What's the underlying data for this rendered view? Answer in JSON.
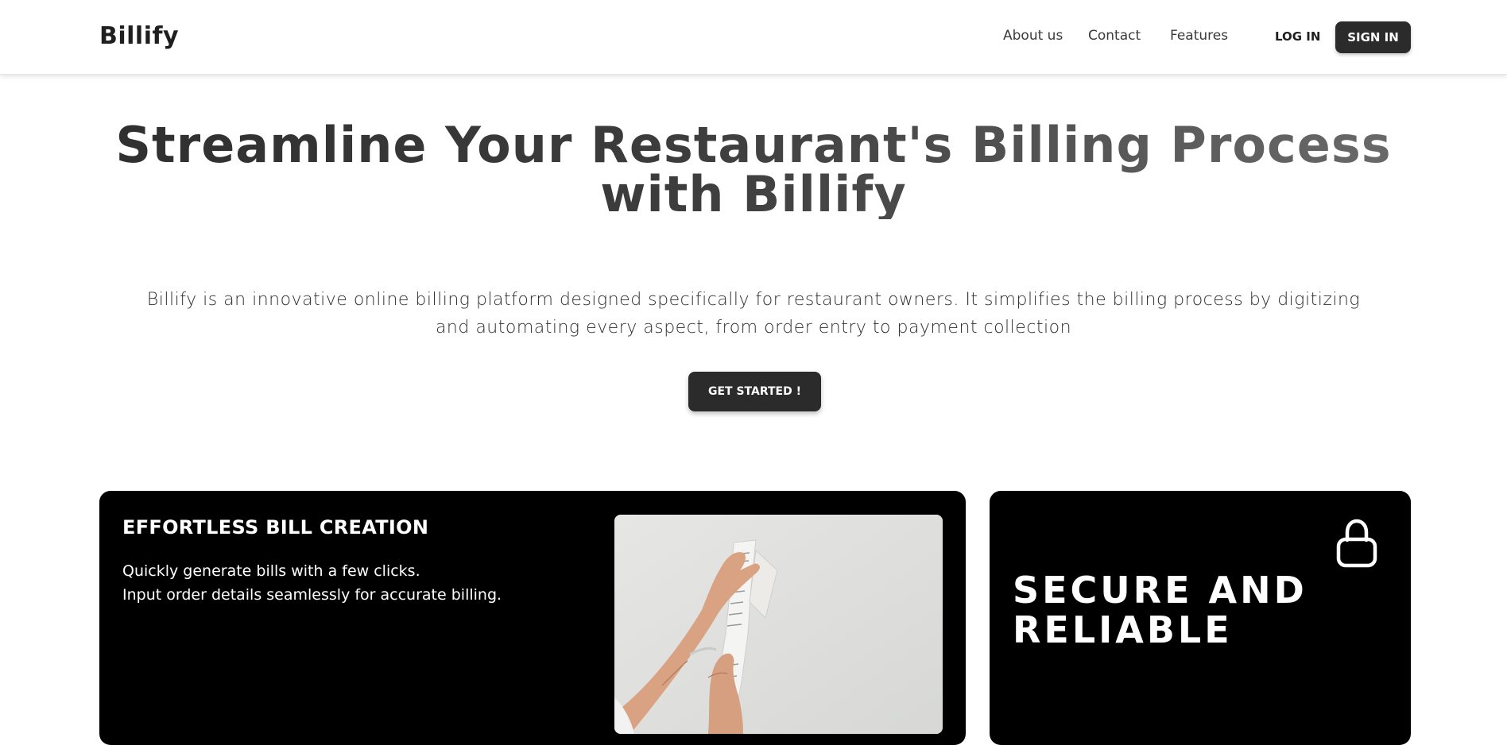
{
  "header": {
    "logo": "Billify",
    "nav": {
      "about": "About us",
      "contact": "Contact",
      "features": "Features"
    },
    "login_label": "LOG IN",
    "signin_label": "SIGN IN"
  },
  "hero": {
    "title": "Streamline Your Restaurant's Billing Process with Billify",
    "description": "Billify is an innovative online billing platform designed specifically for restaurant owners. It simplifies the billing process by digitizing and automating every aspect, from order entry to payment collection",
    "cta_label": "GET STARTED !"
  },
  "features": {
    "bill_creation": {
      "title": "EFFORTLESS BILL CREATION",
      "line1": "Quickly generate bills with a few clicks.",
      "line2": "Input order details seamlessly for accurate billing.",
      "image_icon": "receipt-photo"
    },
    "secure": {
      "title": "SECURE AND RELIABLE",
      "icon": "lock-icon"
    }
  },
  "colors": {
    "dark": "#2b2b2b",
    "card_bg": "#000000",
    "white": "#ffffff"
  }
}
